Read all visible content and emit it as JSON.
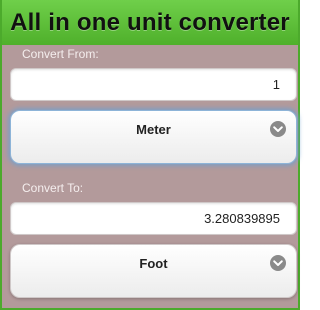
{
  "header": {
    "title": "All in one unit converter"
  },
  "from": {
    "label": "Convert From:",
    "value": "1",
    "unit": "Meter"
  },
  "to": {
    "label": "Convert To:",
    "value": "3.280839895",
    "unit": "Foot"
  },
  "colors": {
    "header_green": "#4fb02b",
    "content_background": "#b39a9b",
    "focus_glow": "#6ea0d2"
  },
  "icons": {
    "dropdown": "chevron-down-circle-icon"
  }
}
